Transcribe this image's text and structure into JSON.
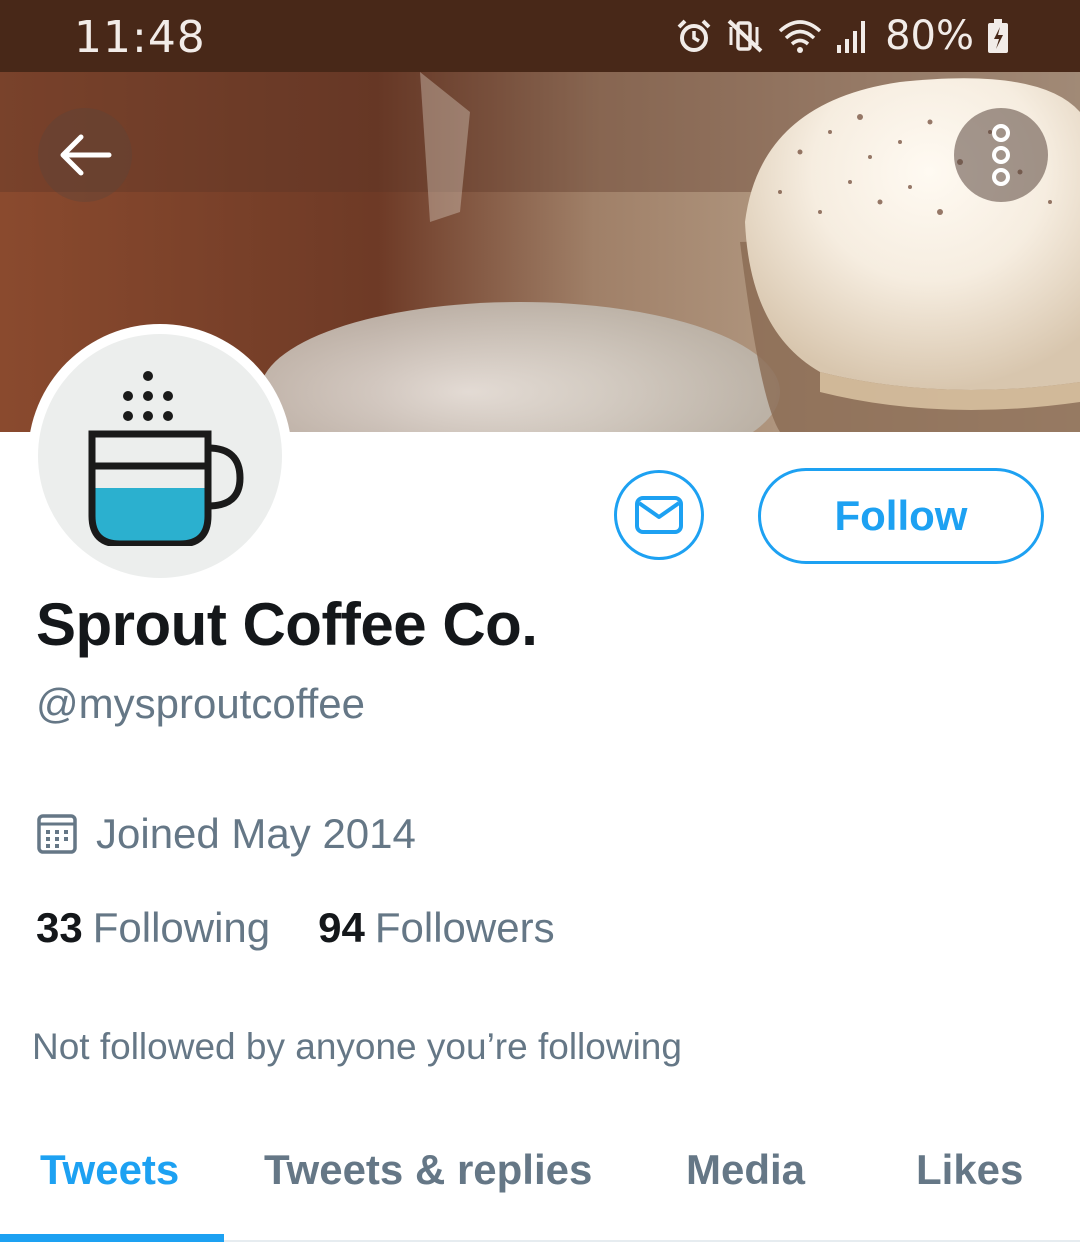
{
  "status_bar": {
    "time": "11:48",
    "battery_percent": "80%",
    "icons": [
      "alarm-icon",
      "vibrate-mute-icon",
      "wifi-icon",
      "signal-icon",
      "battery-charging-icon"
    ]
  },
  "header": {
    "back_icon": "arrow-left-icon",
    "more_icon": "more-vertical-icon"
  },
  "profile": {
    "name": "Sprout Coffee Co.",
    "handle": "@mysproutcoffee",
    "joined": "Joined May 2014",
    "following_count": "33",
    "following_label": "Following",
    "followers_count": "94",
    "followers_label": "Followers",
    "followed_by": "Not followed by anyone you’re following"
  },
  "actions": {
    "message_icon": "mail-icon",
    "follow_label": "Follow"
  },
  "tabs": [
    {
      "label": "Tweets",
      "active": true
    },
    {
      "label": "Tweets & replies",
      "active": false
    },
    {
      "label": "Media",
      "active": false
    },
    {
      "label": "Likes",
      "active": false
    }
  ],
  "colors": {
    "accent": "#1da1f2",
    "status_bar_bg": "#482818",
    "text_primary": "#14171a",
    "text_secondary": "#657786"
  }
}
